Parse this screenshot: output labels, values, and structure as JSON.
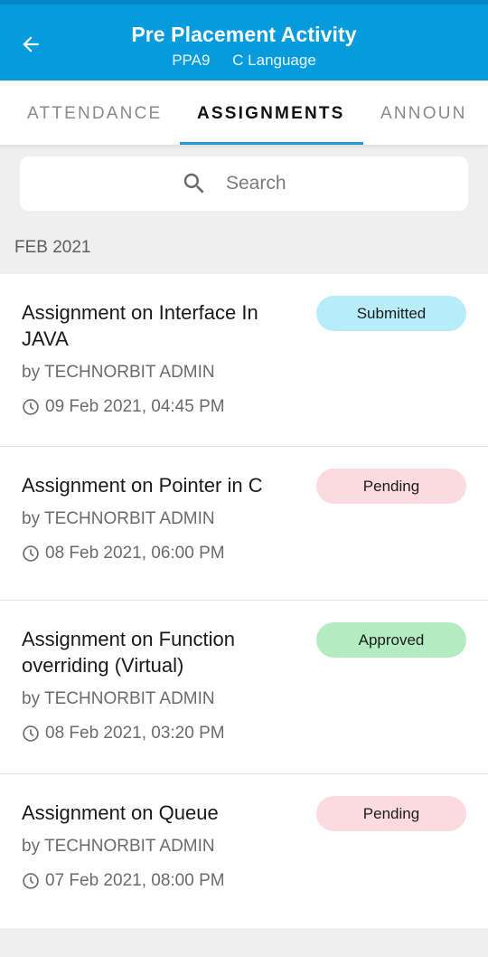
{
  "header": {
    "title": "Pre Placement Activity",
    "code": "PPA9",
    "subject": "C Language",
    "back_icon": "arrow-left-icon",
    "color": "#069bdc"
  },
  "tabs": [
    {
      "label": "ATTENDANCE",
      "active": false
    },
    {
      "label": "ASSIGNMENTS",
      "active": true
    },
    {
      "label": "ANNOUNCEMENTS",
      "active": false,
      "visible_text": "ANNOUN"
    }
  ],
  "search": {
    "placeholder": "Search",
    "value": "",
    "icon": "search-icon"
  },
  "section": {
    "label": "FEB 2021"
  },
  "status_colors": {
    "Submitted": "#b7ecf9",
    "Pending": "#fbdbe0",
    "Approved": "#b4ecc2"
  },
  "assignments": [
    {
      "title": "Assignment on Interface In JAVA",
      "author": "by TECHNORBIT ADMIN",
      "datetime": "09 Feb 2021, 04:45 PM",
      "status": "Submitted"
    },
    {
      "title": "Assignment on Pointer in C",
      "author": "by TECHNORBIT ADMIN",
      "datetime": "08 Feb 2021, 06:00 PM",
      "status": "Pending"
    },
    {
      "title": "Assignment on Function overriding (Virtual)",
      "author": "by TECHNORBIT ADMIN",
      "datetime": "08 Feb 2021, 03:20 PM",
      "status": "Approved"
    },
    {
      "title": "Assignment on Queue",
      "author": "by TECHNORBIT ADMIN",
      "datetime": "07 Feb 2021, 08:00 PM",
      "status": "Pending"
    }
  ]
}
